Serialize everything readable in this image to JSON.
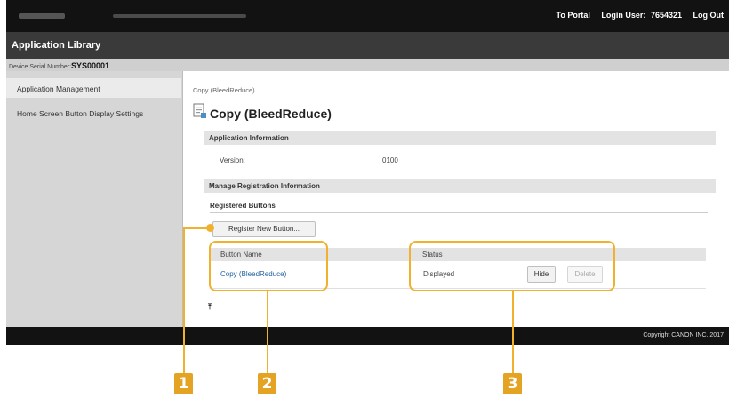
{
  "topbar": {
    "to_portal": "To Portal",
    "login_user_label": "Login User:",
    "login_user_value": "7654321",
    "log_out": "Log Out"
  },
  "app_title": "Application Library",
  "serial": {
    "label": "Device Serial Number:",
    "value": "SYS00001"
  },
  "sidebar": {
    "items": [
      {
        "label": "Application Management"
      },
      {
        "label": "Home Screen Button Display Settings"
      }
    ]
  },
  "main": {
    "breadcrumb": "Copy (BleedReduce)",
    "title": "Copy (BleedReduce)",
    "app_info": {
      "heading": "Application Information",
      "version_label": "Version:",
      "version_value": "0100"
    },
    "manage": {
      "heading": "Manage Registration Information",
      "registered_buttons": "Registered Buttons",
      "register_new": "Register New Button...",
      "columns": {
        "name": "Button Name",
        "status": "Status"
      },
      "rows": [
        {
          "name": "Copy (BleedReduce)",
          "status": "Displayed",
          "hide": "Hide",
          "delete": "Delete"
        }
      ]
    },
    "top_arrow": "⤒"
  },
  "footer": {
    "copyright": "Copyright CANON INC. 2017"
  },
  "callouts": [
    "1",
    "2",
    "3"
  ],
  "colors": {
    "highlight": "#f2b12c",
    "callout": "#e5a324",
    "link": "#1f5e9e",
    "header": "#121212"
  }
}
